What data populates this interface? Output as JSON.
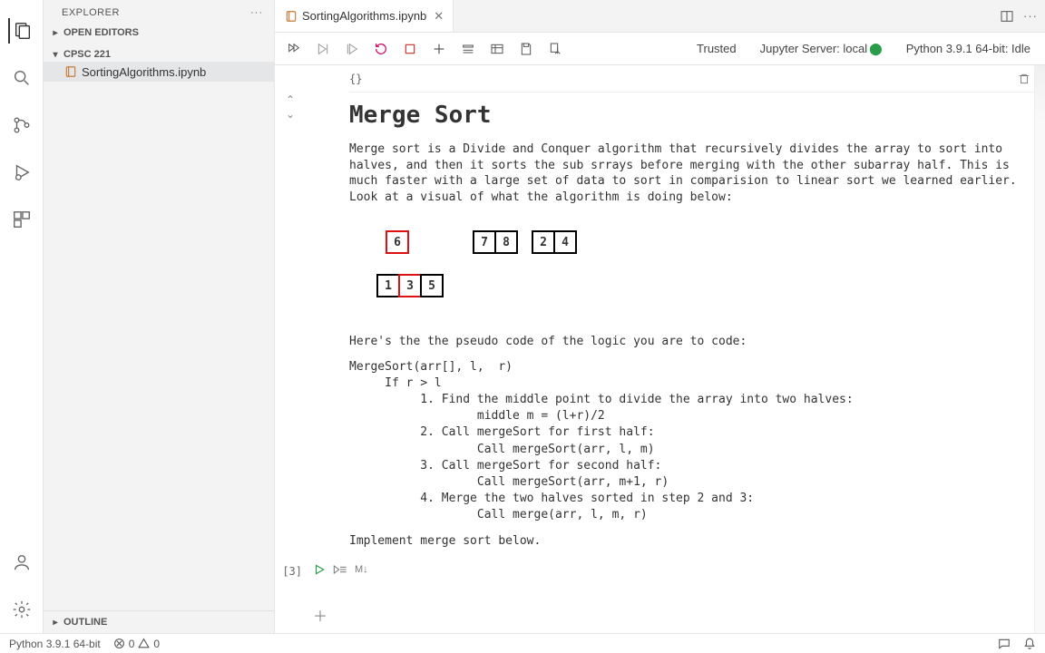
{
  "sidebar": {
    "title": "EXPLORER",
    "open_editors": "OPEN EDITORS",
    "folder": "CPSC 221",
    "file": "SortingAlgorithms.ipynb",
    "outline": "OUTLINE"
  },
  "tab": {
    "filename": "SortingAlgorithms.ipynb"
  },
  "notebook_toolbar": {
    "trusted": "Trusted",
    "server": "Jupyter Server: local",
    "kernel": "Python 3.9.1 64-bit: Idle"
  },
  "cell_markdown": {
    "braces": "{}",
    "heading": "Merge Sort",
    "intro": "Merge sort is a Divide and Conquer algorithm that recursively divides the array to sort into halves, and then it sorts the sub srrays before merging with the other subarray half. This is much faster with a large set of data to sort in comparision to linear sort we learned earlier. Look at a visual of what the algorithm is doing below:",
    "visual": {
      "row1": {
        "a": "6",
        "b1": "7",
        "b2": "8",
        "c1": "2",
        "c2": "4"
      },
      "row2": {
        "a": "1",
        "b": "3",
        "c": "5"
      }
    },
    "pseudo_intro": "Here's the the pseudo code of the logic you are to code:",
    "pseudo": "MergeSort(arr[], l,  r)\n     If r > l\n          1. Find the middle point to divide the array into two halves:\n                  middle m = (l+r)/2\n          2. Call mergeSort for first half:\n                  Call mergeSort(arr, l, m)\n          3. Call mergeSort for second half:\n                  Call mergeSort(arr, m+1, r)\n          4. Merge the two halves sorted in step 2 and 3:\n                  Call merge(arr, l, m, r)",
    "impl": "Implement merge sort below."
  },
  "cell_code": {
    "exec": "[3]",
    "md_label": "M↓"
  },
  "statusbar": {
    "python": "Python 3.9.1 64-bit",
    "errors": "0",
    "warnings": "0"
  }
}
